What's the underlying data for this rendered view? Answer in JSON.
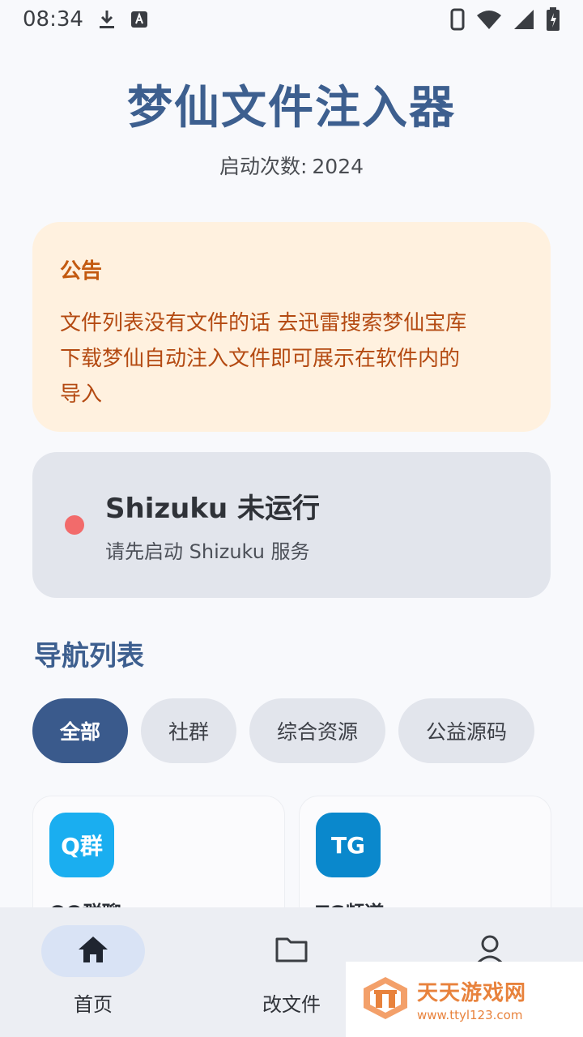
{
  "status_bar": {
    "time": "08:34"
  },
  "header": {
    "title": "梦仙文件注入器",
    "launch_label": "启动次数:",
    "launch_count": "2024"
  },
  "notice": {
    "title": "公告",
    "lines": [
      "文件列表没有文件的话 去迅雷搜索梦仙宝库",
      "下载梦仙自动注入文件即可展示在软件内的",
      "导入"
    ]
  },
  "shizuku": {
    "title": "Shizuku 未运行",
    "subtitle": "请先启动 Shizuku 服务",
    "status_color": "#f26b6b"
  },
  "nav_section": {
    "title": "导航列表"
  },
  "chips": [
    {
      "label": "全部",
      "active": true
    },
    {
      "label": "社群",
      "active": false
    },
    {
      "label": "综合资源",
      "active": false
    },
    {
      "label": "公益源码",
      "active": false
    }
  ],
  "link_cards": [
    {
      "logo_text": "Q群",
      "name": "QQ群聊",
      "color": "#1aaef0"
    },
    {
      "logo_text": "TG",
      "name": "TG频道",
      "color": "#0a88cc"
    }
  ],
  "bottom_nav": [
    {
      "label": "首页",
      "icon": "home-icon",
      "active": true
    },
    {
      "label": "改文件",
      "icon": "folder-icon",
      "active": false
    },
    {
      "label": "",
      "icon": "person-icon",
      "active": false
    }
  ],
  "watermark": {
    "title": "天天游戏网",
    "url": "www.ttyl123.com"
  },
  "colors": {
    "accent": "#3a5a8c",
    "title": "#3d5f8f",
    "notice_bg": "#fff1df",
    "notice_text": "#b44a12"
  }
}
